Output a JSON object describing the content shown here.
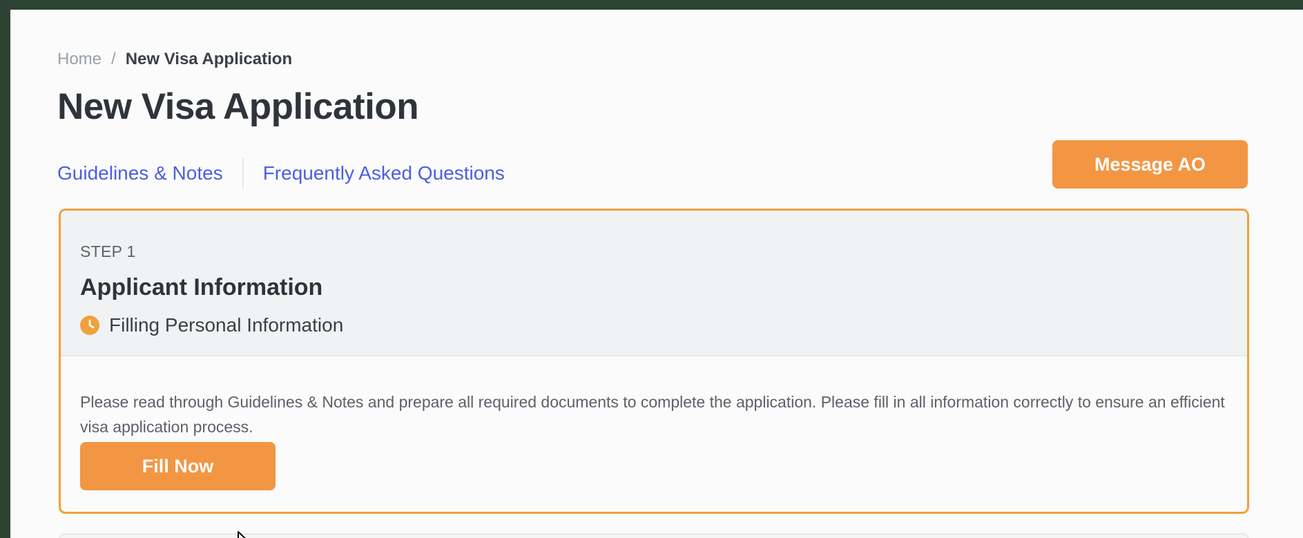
{
  "breadcrumb": {
    "home": "Home",
    "separator": "/",
    "current": "New Visa Application"
  },
  "page": {
    "title": "New Visa Application"
  },
  "links": {
    "guidelines": "Guidelines & Notes",
    "faq": "Frequently Asked Questions"
  },
  "actions": {
    "message_label": "Message AO"
  },
  "step": {
    "label": "STEP 1",
    "title": "Applicant Information",
    "status": "Filling Personal Information",
    "status_icon": "clock-icon",
    "description": "Please read through Guidelines & Notes and prepare all required documents to complete the application. Please fill in all information correctly to ensure an efficient visa application process.",
    "button_label": "Fill Now"
  },
  "colors": {
    "accent": "#f29644",
    "card_border": "#f0a03c",
    "link": "#4c5ee0",
    "background": "#2c4232"
  }
}
